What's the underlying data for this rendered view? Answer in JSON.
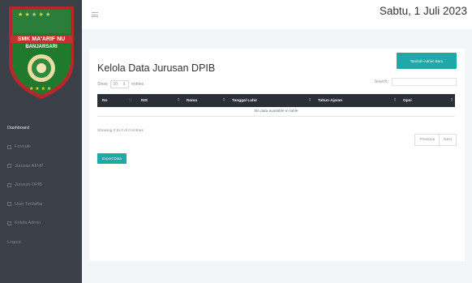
{
  "logo": {
    "school_name": "SMK MA'ARIF NU",
    "location": "BANJARSARI"
  },
  "sidebar": {
    "items": [
      {
        "label": "Dashboard"
      },
      {
        "label": "Formulir"
      },
      {
        "label": "Jurusan AFHP"
      },
      {
        "label": "Jurusan DPIB"
      },
      {
        "label": "User Terdaftar"
      },
      {
        "label": "Kelola Admin"
      },
      {
        "label": "Logout"
      }
    ]
  },
  "header": {
    "date": "Sabtu, 1 Juli 2023"
  },
  "main": {
    "title": "Kelola Data Jurusan DPIB",
    "add_button": "Tambah Admin Baru",
    "show_label": "Show",
    "entries_value": "10",
    "entries_label": "entries",
    "search_label": "Search:",
    "columns": [
      "No",
      "NIS",
      "Nama",
      "Tanggal Lahir",
      "Tahun Ajaran",
      "Opsi"
    ],
    "empty_message": "No data available in table",
    "info": "Showing 0 to 0 of 0 entries",
    "pager_previous": "Previous",
    "pager_next": "Next",
    "export_button": "Export Data"
  },
  "colors": {
    "sidebar_bg": "#3a3f48",
    "accent": "#1ea9a6",
    "table_header": "#2b2f36",
    "logo_green": "#1f7a2e",
    "logo_red": "#b8262b"
  }
}
